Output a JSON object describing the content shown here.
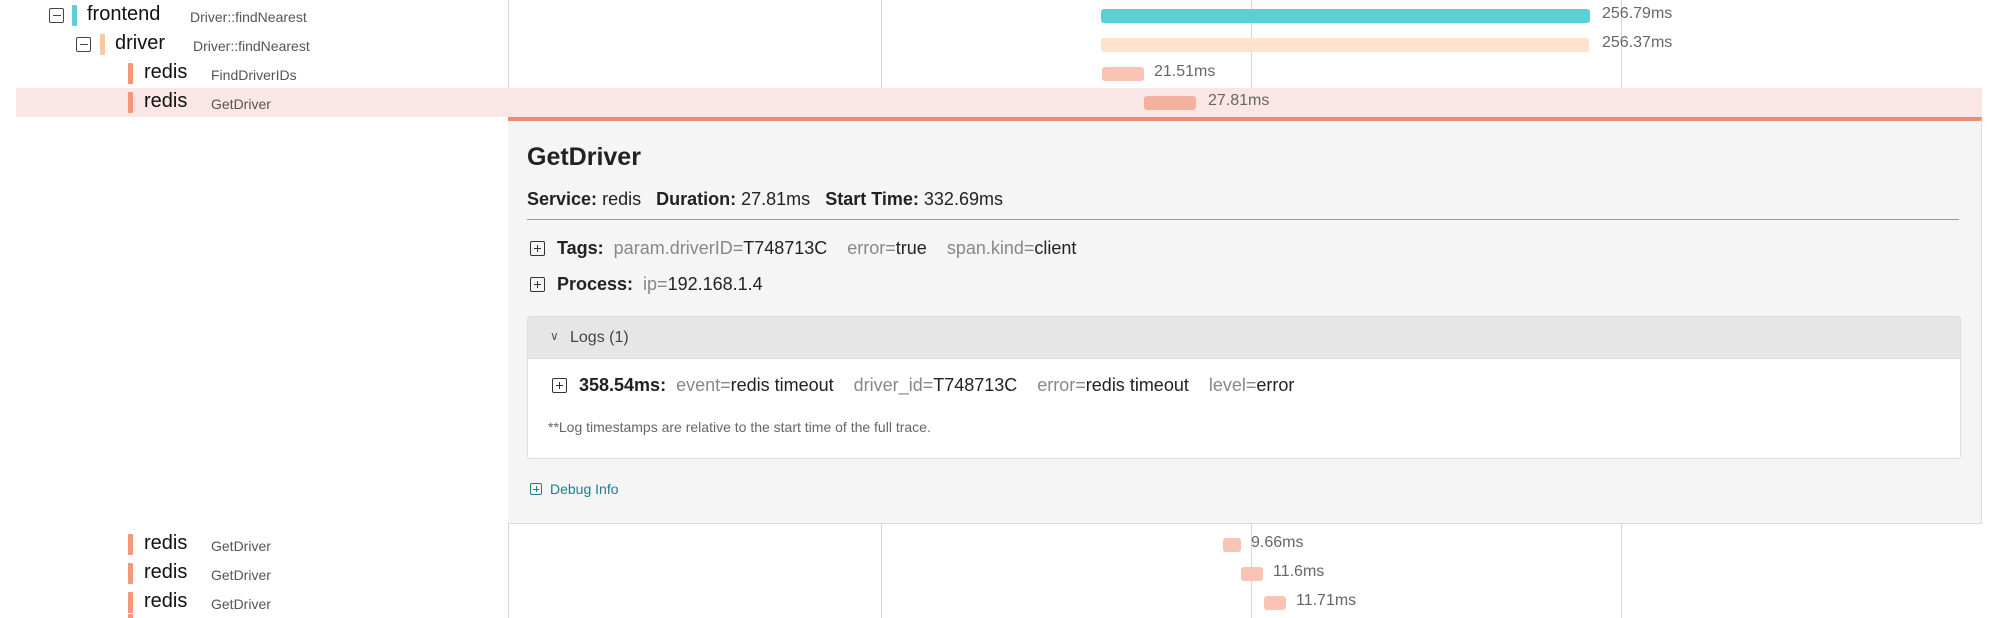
{
  "colors": {
    "frontend": "#5ccfd4",
    "driver": "#f7c8a2",
    "redis": "#f6967a",
    "driver_bar": "#fde2cd",
    "redis_bar": "#f9c4b3",
    "redis_bar_selected": "#f4b1a0",
    "selected_row_bg": "#fbe6e6",
    "accent_border": "#f28b6a"
  },
  "rows_top": [
    {
      "service": "frontend",
      "operation": "Driver::findNearest",
      "duration": "256.79ms",
      "expanded": true,
      "selected": false
    },
    {
      "service": "driver",
      "operation": "Driver::findNearest",
      "duration": "256.37ms",
      "expanded": true,
      "selected": false
    },
    {
      "service": "redis",
      "operation": "FindDriverIDs",
      "duration": "21.51ms",
      "selected": false
    },
    {
      "service": "redis",
      "operation": "GetDriver",
      "duration": "27.81ms",
      "selected": true
    }
  ],
  "detail": {
    "title": "GetDriver",
    "service_label": "Service:",
    "service_value": "redis",
    "duration_label": "Duration:",
    "duration_value": "27.81ms",
    "start_label": "Start Time:",
    "start_value": "332.69ms",
    "tags_label": "Tags:",
    "tags": [
      {
        "key": "param.driverID=",
        "value": "T748713C"
      },
      {
        "key": "error=",
        "value": "true"
      },
      {
        "key": "span.kind=",
        "value": "client"
      }
    ],
    "process_label": "Process:",
    "process": [
      {
        "key": "ip=",
        "value": "192.168.1.4"
      }
    ],
    "logs_title": "Logs (1)",
    "log_time": "358.54ms:",
    "log_fields": [
      {
        "key": "event=",
        "value": "redis timeout"
      },
      {
        "key": "driver_id=",
        "value": "T748713C"
      },
      {
        "key": "error=",
        "value": "redis timeout"
      },
      {
        "key": "level=",
        "value": "error"
      }
    ],
    "log_note": "**Log timestamps are relative to the start time of the full trace.",
    "debug_label": "Debug Info"
  },
  "rows_bottom": [
    {
      "service": "redis",
      "operation": "GetDriver",
      "duration": "9.66ms"
    },
    {
      "service": "redis",
      "operation": "GetDriver",
      "duration": "11.6ms"
    },
    {
      "service": "redis",
      "operation": "GetDriver",
      "duration": "11.71ms"
    }
  ]
}
